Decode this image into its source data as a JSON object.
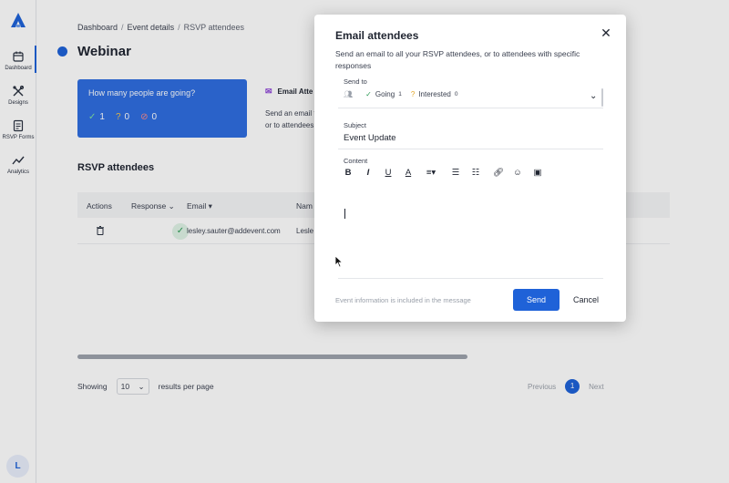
{
  "sidebar": {
    "logo": "addevent-logo",
    "items": [
      {
        "label": "Dashboard",
        "icon": "calendar-icon"
      },
      {
        "label": "Designs",
        "icon": "tools-icon"
      },
      {
        "label": "RSVP Forms",
        "icon": "form-icon"
      },
      {
        "label": "Analytics",
        "icon": "chart-icon"
      }
    ],
    "avatar_initial": "L"
  },
  "breadcrumb": {
    "items": [
      "Dashboard",
      "Event details",
      "RSVP attendees"
    ],
    "separator": "/"
  },
  "page": {
    "title": "Webinar",
    "title_dot_color": "#1f62d8"
  },
  "stats_card": {
    "question": "How many people are going?",
    "going": "1",
    "interested": "0",
    "declined": "0",
    "bg_color": "#2f6ee0"
  },
  "email_card": {
    "title": "Email Atte",
    "line1": "Send an email t",
    "line2": "or to attendees"
  },
  "attendees": {
    "section_title": "RSVP attendees",
    "columns": [
      "Actions",
      "Response",
      "Email",
      "Nam"
    ],
    "rows": [
      {
        "email": "lesley.sauter@addevent.com",
        "name": "Lesle",
        "response": "going"
      }
    ]
  },
  "pagination": {
    "showing_label": "Showing",
    "per_page_value": "10",
    "per_page_suffix": "results per page",
    "previous_label": "Previous",
    "current_page": "1",
    "next_label": "Next"
  },
  "modal": {
    "title": "Email attendees",
    "description": "Send an email to all your RSVP attendees, or to attendees with specific responses",
    "send_to": {
      "label": "Send to",
      "going_label": "Going",
      "going_count": "1",
      "interested_label": "Interested",
      "interested_count": "0"
    },
    "subject": {
      "label": "Subject",
      "value": "Event Update"
    },
    "content": {
      "label": "Content",
      "value": ""
    },
    "footer_note": "Event information is included in the message",
    "send_label": "Send",
    "cancel_label": "Cancel",
    "accent_color": "#1f62d8"
  }
}
